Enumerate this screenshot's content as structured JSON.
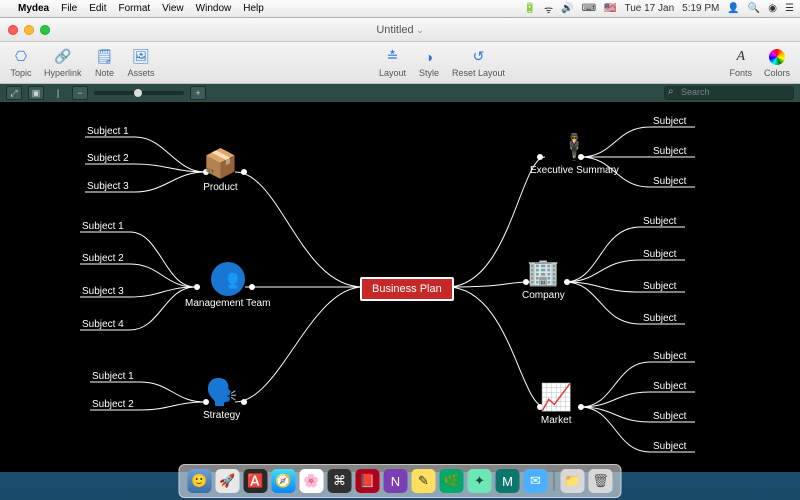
{
  "menubar": {
    "apple": "",
    "app": "Mydea",
    "items": [
      "File",
      "Edit",
      "Format",
      "View",
      "Window",
      "Help"
    ],
    "status": {
      "date": "Tue 17 Jan",
      "time": "5:19 PM"
    }
  },
  "window": {
    "title": "Untitled"
  },
  "toolbar": {
    "left": [
      {
        "label": "Topic",
        "glyph": "⎔"
      },
      {
        "label": "Hyperlink",
        "glyph": "🔗"
      },
      {
        "label": "Note",
        "glyph": "🗒"
      },
      {
        "label": "Assets",
        "glyph": "🖼"
      }
    ],
    "center": [
      {
        "label": "Layout",
        "glyph": "≛"
      },
      {
        "label": "Style",
        "glyph": "◑"
      },
      {
        "label": "Reset Layout",
        "glyph": "↺"
      }
    ],
    "right": [
      {
        "label": "Fonts"
      },
      {
        "label": "Colors"
      }
    ]
  },
  "search": {
    "placeholder": "Search"
  },
  "mindmap": {
    "center": "Business Plan",
    "left": [
      {
        "title": "Product",
        "leaves": [
          "Subject 1",
          "Subject 2",
          "Subject 3"
        ]
      },
      {
        "title": "Management Team",
        "leaves": [
          "Subject 1",
          "Subject 2",
          "Subject 3",
          "Subject 4"
        ]
      },
      {
        "title": "Strategy",
        "leaves": [
          "Subject 1",
          "Subject 2"
        ]
      }
    ],
    "right": [
      {
        "title": "Executive Summary",
        "leaves": [
          "Subject",
          "Subject",
          "Subject"
        ]
      },
      {
        "title": "Company",
        "leaves": [
          "Subject",
          "Subject",
          "Subject",
          "Subject"
        ]
      },
      {
        "title": "Market",
        "leaves": [
          "Subject",
          "Subject",
          "Subject",
          "Subject"
        ]
      }
    ]
  }
}
